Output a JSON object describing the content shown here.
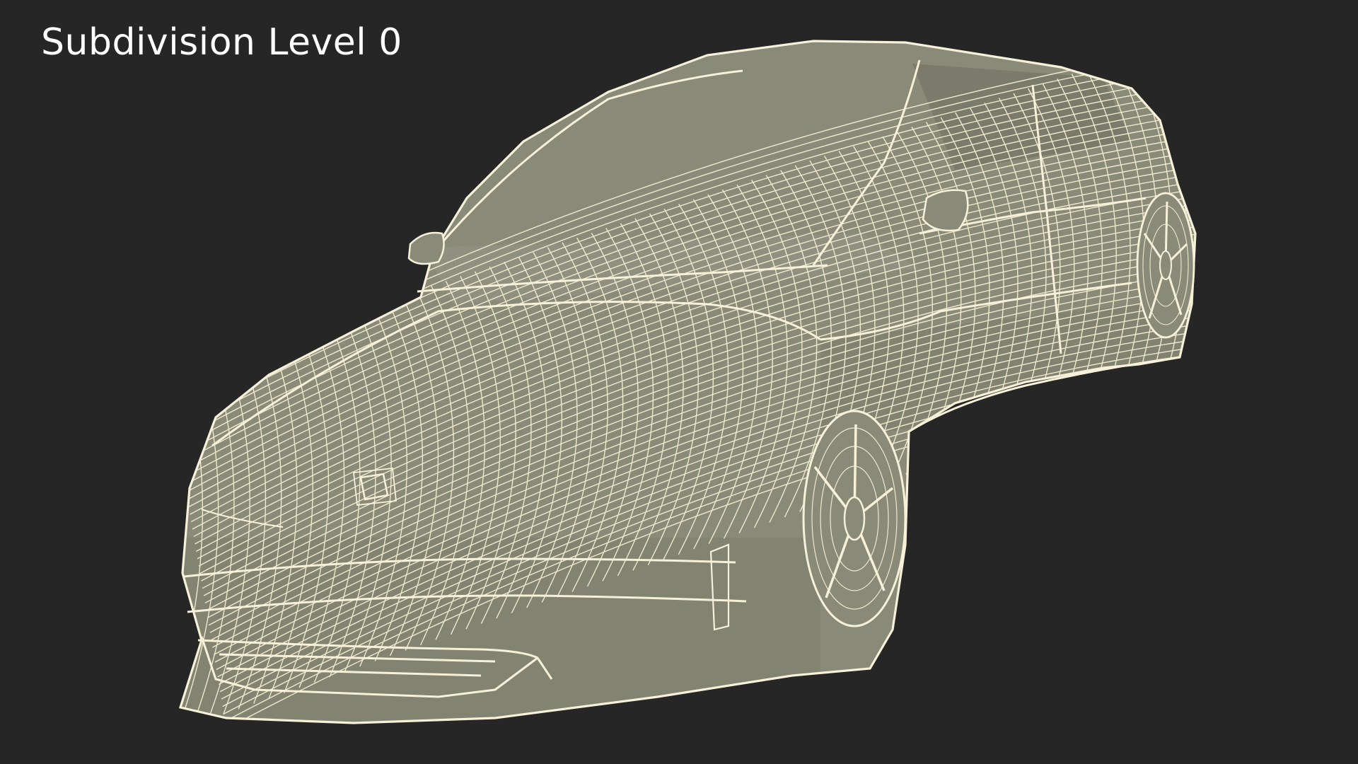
{
  "viewport": {
    "label": "Subdivision Level 0",
    "background": "#262626",
    "surface_color": "#8b8b7b",
    "wire_color": "#f3eed2",
    "subject": "car-wireframe-render"
  }
}
